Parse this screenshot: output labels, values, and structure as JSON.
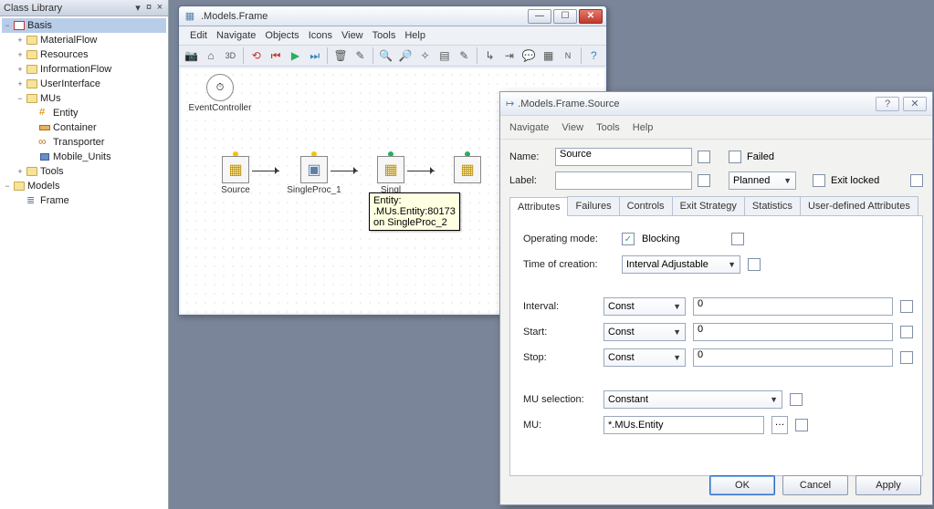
{
  "classlib": {
    "title": "Class Library",
    "nodes": {
      "basis": "Basis",
      "materialflow": "MaterialFlow",
      "resources": "Resources",
      "informationflow": "InformationFlow",
      "userinterface": "UserInterface",
      "mus": "MUs",
      "entity": "Entity",
      "container": "Container",
      "transporter": "Transporter",
      "mobile_units": "Mobile_Units",
      "tools": "Tools",
      "models": "Models",
      "frame": "Frame"
    }
  },
  "frame_win": {
    "title": ".Models.Frame",
    "menu": {
      "edit": "Edit",
      "navigate": "Navigate",
      "objects": "Objects",
      "icons": "Icons",
      "view": "View",
      "tools": "Tools",
      "help": "Help"
    },
    "nodes": {
      "event": "EventController",
      "source": "Source",
      "sp1": "SingleProc_1",
      "sp2": "Singl"
    },
    "tooltip": {
      "l1": "Entity:",
      "l2": ".MUs.Entity:80173",
      "l3": "on SingleProc_2"
    }
  },
  "dialog": {
    "title": ".Models.Frame.Source",
    "menu": {
      "navigate": "Navigate",
      "view": "View",
      "tools": "Tools",
      "help": "Help"
    },
    "name_label": "Name:",
    "name_value": "Source",
    "failed_label": "Failed",
    "label_label": "Label:",
    "label_value": "",
    "planned_value": "Planned",
    "exitlocked_label": "Exit locked",
    "tabs": {
      "attributes": "Attributes",
      "failures": "Failures",
      "controls": "Controls",
      "exit": "Exit Strategy",
      "statistics": "Statistics",
      "user": "User-defined Attributes"
    },
    "opmode_label": "Operating mode:",
    "blocking_label": "Blocking",
    "toc_label": "Time of creation:",
    "toc_value": "Interval Adjustable",
    "interval_label": "Interval:",
    "start_label": "Start:",
    "stop_label": "Stop:",
    "dist_value": "Const",
    "interval_value": "0",
    "start_value": "0",
    "stop_value": "0",
    "musel_label": "MU selection:",
    "musel_value": "Constant",
    "mu_label": "MU:",
    "mu_value": "*.MUs.Entity",
    "ok": "OK",
    "cancel": "Cancel",
    "apply": "Apply"
  }
}
